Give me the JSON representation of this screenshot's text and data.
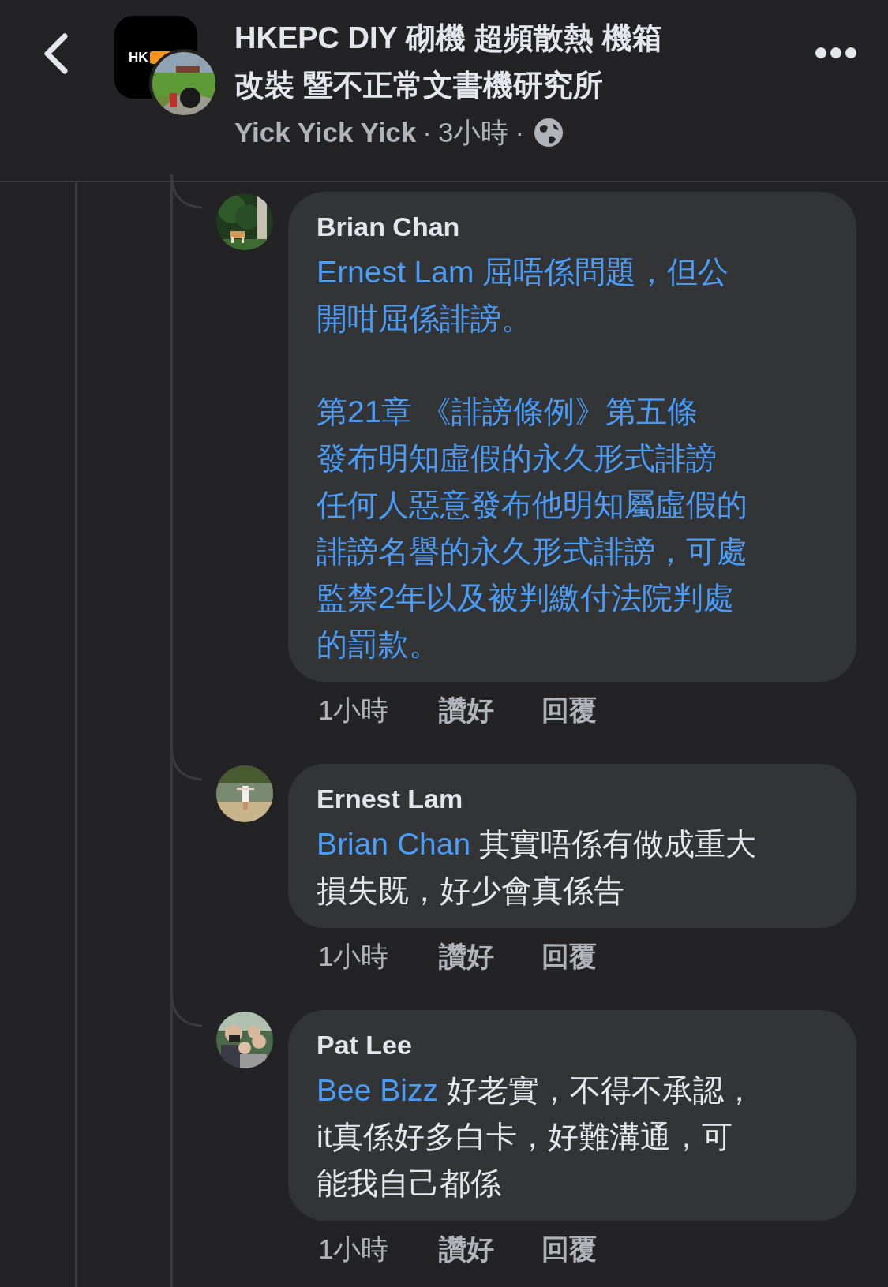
{
  "header": {
    "group_name": "HKEPC DIY 砌機 超頻散熱 機箱改裝 暨不正常文書機研究所",
    "logo_text": "HK",
    "author": "Yick Yick Yick",
    "separator_1": "·",
    "time": "3小時",
    "separator_2": "·"
  },
  "comments": [
    {
      "author": "Brian Chan",
      "text_is_link": true,
      "paragraphs": [
        {
          "mention": "Ernest Lam",
          "text": " 屈唔係問題，但公開咁屈係誹謗。",
          "spaced": true
        },
        {
          "text": "第21章 《誹謗條例》第五條",
          "spaced": false
        },
        {
          "text": "發布明知虛假的永久形式誹謗",
          "spaced": false
        },
        {
          "text": "任何人惡意發布他明知屬虛假的誹謗名譽的永久形式誹謗，可處監禁2年以及被判繳付法院判處的罰款。",
          "spaced": false
        }
      ],
      "time": "1小時",
      "like": "讚好",
      "reply": "回覆"
    },
    {
      "author": "Ernest Lam",
      "text_is_link": false,
      "paragraphs": [
        {
          "mention": "Brian Chan",
          "text": " 其實唔係有做成重大損失既，好少會真係告",
          "spaced": false
        }
      ],
      "time": "1小時",
      "like": "讚好",
      "reply": "回覆"
    },
    {
      "author": "Pat Lee",
      "text_is_link": false,
      "paragraphs": [
        {
          "mention": "Bee Bizz",
          "text": " 好老實，不得不承認，it真係好多白卡，好難溝通，可能我自己都係",
          "spaced": false
        }
      ],
      "time": "1小時",
      "like": "讚好",
      "reply": "回覆"
    }
  ]
}
